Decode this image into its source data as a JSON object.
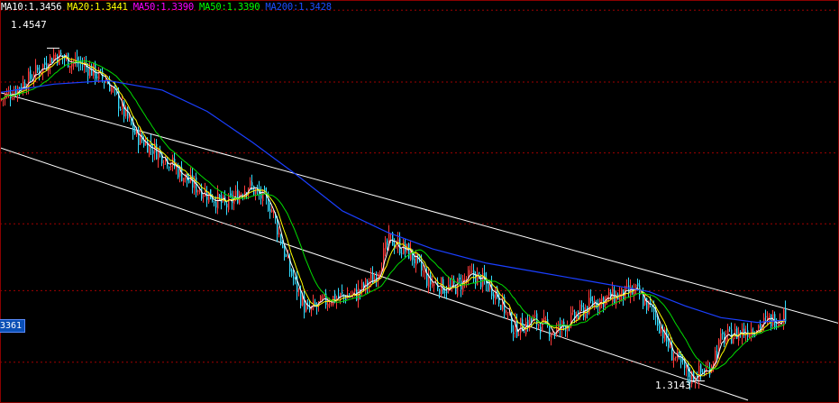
{
  "legend": [
    {
      "label": "MA10:1.3456",
      "color": "#ffffff"
    },
    {
      "label": "MA20:1.3441",
      "color": "#ffff00"
    },
    {
      "label": "MA50:1.3390",
      "color": "#ff00ff"
    },
    {
      "label": "MA50:1.3390",
      "color": "#00ff00"
    },
    {
      "label": "MA200:1.3428",
      "color": "#1a4fff"
    }
  ],
  "price_tag": "3361",
  "high_label": "1.4547",
  "low_label": "1.3143",
  "chart_data": {
    "type": "candlestick",
    "ylim": [
      1.305,
      1.475
    ],
    "high": 1.4547,
    "low": 1.3143,
    "grid": "horizontal-dotted",
    "colors": {
      "up": "#ff3b3b",
      "down": "#33ddff",
      "ma_white": "#ffffff",
      "ma_yellow": "#ffff00",
      "ma_green": "#00dd00",
      "ma200": "#1a3fff",
      "channel": "#ffffff"
    },
    "trend": [
      [
        0,
        1.433
      ],
      [
        30,
        1.441
      ],
      [
        60,
        1.452
      ],
      [
        95,
        1.447
      ],
      [
        120,
        1.44
      ],
      [
        150,
        1.418
      ],
      [
        185,
        1.408
      ],
      [
        210,
        1.398
      ],
      [
        235,
        1.392
      ],
      [
        250,
        1.388
      ],
      [
        275,
        1.397
      ],
      [
        300,
        1.388
      ],
      [
        320,
        1.362
      ],
      [
        340,
        1.343
      ],
      [
        365,
        1.349
      ],
      [
        395,
        1.351
      ],
      [
        415,
        1.358
      ],
      [
        432,
        1.374
      ],
      [
        455,
        1.368
      ],
      [
        475,
        1.356
      ],
      [
        500,
        1.353
      ],
      [
        525,
        1.359
      ],
      [
        550,
        1.352
      ],
      [
        570,
        1.336
      ],
      [
        590,
        1.34
      ],
      [
        615,
        1.335
      ],
      [
        640,
        1.342
      ],
      [
        660,
        1.348
      ],
      [
        685,
        1.35
      ],
      [
        705,
        1.352
      ],
      [
        725,
        1.343
      ],
      [
        745,
        1.326
      ],
      [
        765,
        1.316
      ],
      [
        785,
        1.319
      ],
      [
        800,
        1.332
      ],
      [
        830,
        1.336
      ],
      [
        850,
        1.339
      ],
      [
        872,
        1.343
      ]
    ],
    "channel_lines": [
      {
        "start": [
          0,
          1.436
        ],
        "end": [
          931,
          1.3386
        ]
      },
      {
        "start": [
          0,
          1.4127
        ],
        "end": [
          830,
          1.3062
        ]
      }
    ],
    "grid_levels": [
      1.4707,
      1.4404,
      1.4105,
      1.3806,
      1.3524,
      1.3222
    ],
    "ma200": [
      [
        0,
        1.436
      ],
      [
        60,
        1.4395
      ],
      [
        120,
        1.441
      ],
      [
        180,
        1.437
      ],
      [
        230,
        1.428
      ],
      [
        280,
        1.415
      ],
      [
        330,
        1.401
      ],
      [
        380,
        1.386
      ],
      [
        430,
        1.377
      ],
      [
        480,
        1.37
      ],
      [
        540,
        1.364
      ],
      [
        600,
        1.36
      ],
      [
        660,
        1.356
      ],
      [
        720,
        1.352
      ],
      [
        760,
        1.346
      ],
      [
        800,
        1.341
      ],
      [
        840,
        1.339
      ],
      [
        872,
        1.34
      ]
    ]
  }
}
